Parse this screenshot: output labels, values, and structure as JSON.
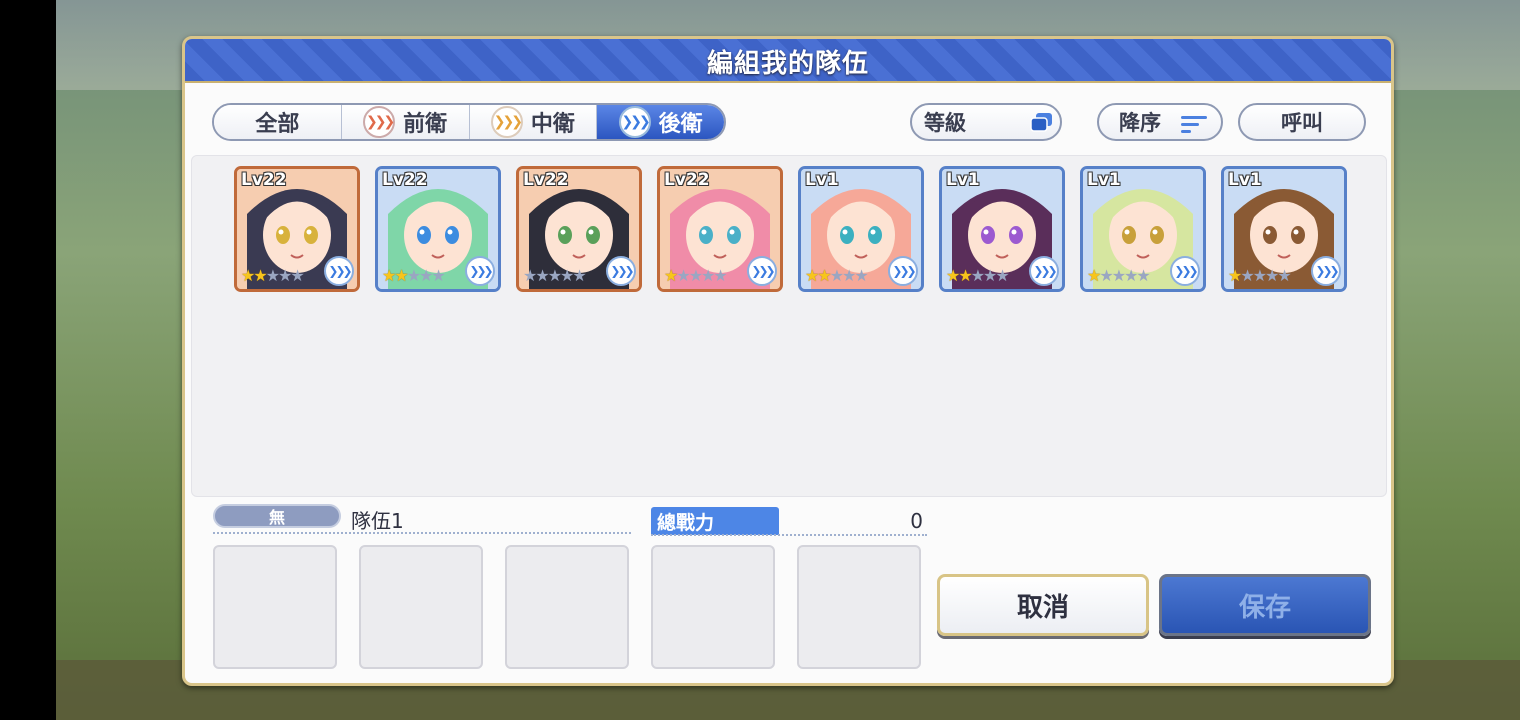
{
  "dialog": {
    "title": "編組我的隊伍"
  },
  "tabs": [
    {
      "label": "全部",
      "icon": null,
      "active": false
    },
    {
      "label": "前衛",
      "icon": "front-role-icon",
      "active": false
    },
    {
      "label": "中衛",
      "icon": "middle-role-icon",
      "active": false
    },
    {
      "label": "後衛",
      "icon": "back-role-icon",
      "active": true
    }
  ],
  "sort": {
    "level_label": "等級",
    "order_label": "降序",
    "call_label": "呼叫"
  },
  "characters": [
    {
      "level": "Lv22",
      "stars": 2,
      "frame": "gold",
      "hair": "#3a3a52",
      "eyes": "#d8b23c"
    },
    {
      "level": "Lv22",
      "stars": 2,
      "frame": "blue",
      "hair": "#7fd6a8",
      "eyes": "#3c8ce0"
    },
    {
      "level": "Lv22",
      "stars": 0,
      "frame": "gold",
      "hair": "#2e2e3a",
      "eyes": "#5aa05a"
    },
    {
      "level": "Lv22",
      "stars": 1,
      "frame": "gold",
      "hair": "#f08ca8",
      "eyes": "#4ab0c8"
    },
    {
      "level": "Lv1",
      "stars": 2,
      "frame": "blue",
      "hair": "#f6a898",
      "eyes": "#3cb0c0"
    },
    {
      "level": "Lv1",
      "stars": 2,
      "frame": "blue",
      "hair": "#5a2e5a",
      "eyes": "#9c5ad0"
    },
    {
      "level": "Lv1",
      "stars": 1,
      "frame": "blue",
      "hair": "#d6e6a0",
      "eyes": "#c8a03a"
    },
    {
      "level": "Lv1",
      "stars": 1,
      "frame": "blue",
      "hair": "#8a5a34",
      "eyes": "#8a5a34"
    }
  ],
  "team": {
    "badge": "無",
    "name": "隊伍1",
    "power_label": "總戰力",
    "power_value": "0"
  },
  "buttons": {
    "cancel": "取消",
    "save": "保存"
  }
}
